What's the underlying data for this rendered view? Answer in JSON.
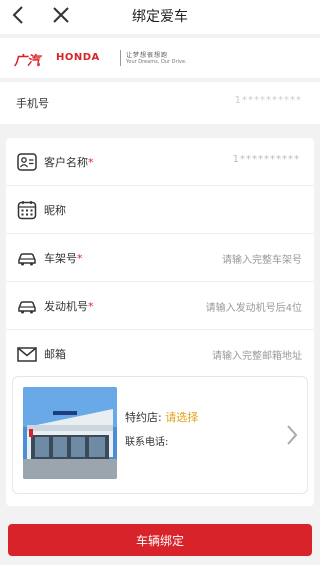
{
  "nav": {
    "title": "绑定爱车",
    "back_icon": "chevron-left-icon",
    "close_icon": "close-icon"
  },
  "brand": {
    "gac": "广汽",
    "honda": "HONDA",
    "slogan_cn": "让梦想很想跑",
    "slogan_en": "Your Dreams, Our Drive."
  },
  "phone": {
    "label": "手机号",
    "value": "1**********"
  },
  "form": {
    "customer_name": {
      "label": "客户名称",
      "required": "*",
      "value": "1**********",
      "icon": "id-card-icon"
    },
    "nickname": {
      "label": "昵称",
      "icon": "calendar-icon"
    },
    "vin": {
      "label": "车架号",
      "required": "*",
      "placeholder": "请输入完整车架号",
      "icon": "car-icon"
    },
    "engine": {
      "label": "发动机号",
      "required": "*",
      "placeholder": "请输入发动机号后4位",
      "icon": "car-icon"
    },
    "email": {
      "label": "邮箱",
      "placeholder": "请输入完整邮箱地址",
      "icon": "mail-icon"
    }
  },
  "dealer": {
    "store_label": "特约店:",
    "store_value": "请选择",
    "phone_label": "联系电话:"
  },
  "submit": {
    "label": "车辆绑定"
  },
  "colors": {
    "accent": "#d8232a",
    "highlight": "#e3a21a"
  }
}
